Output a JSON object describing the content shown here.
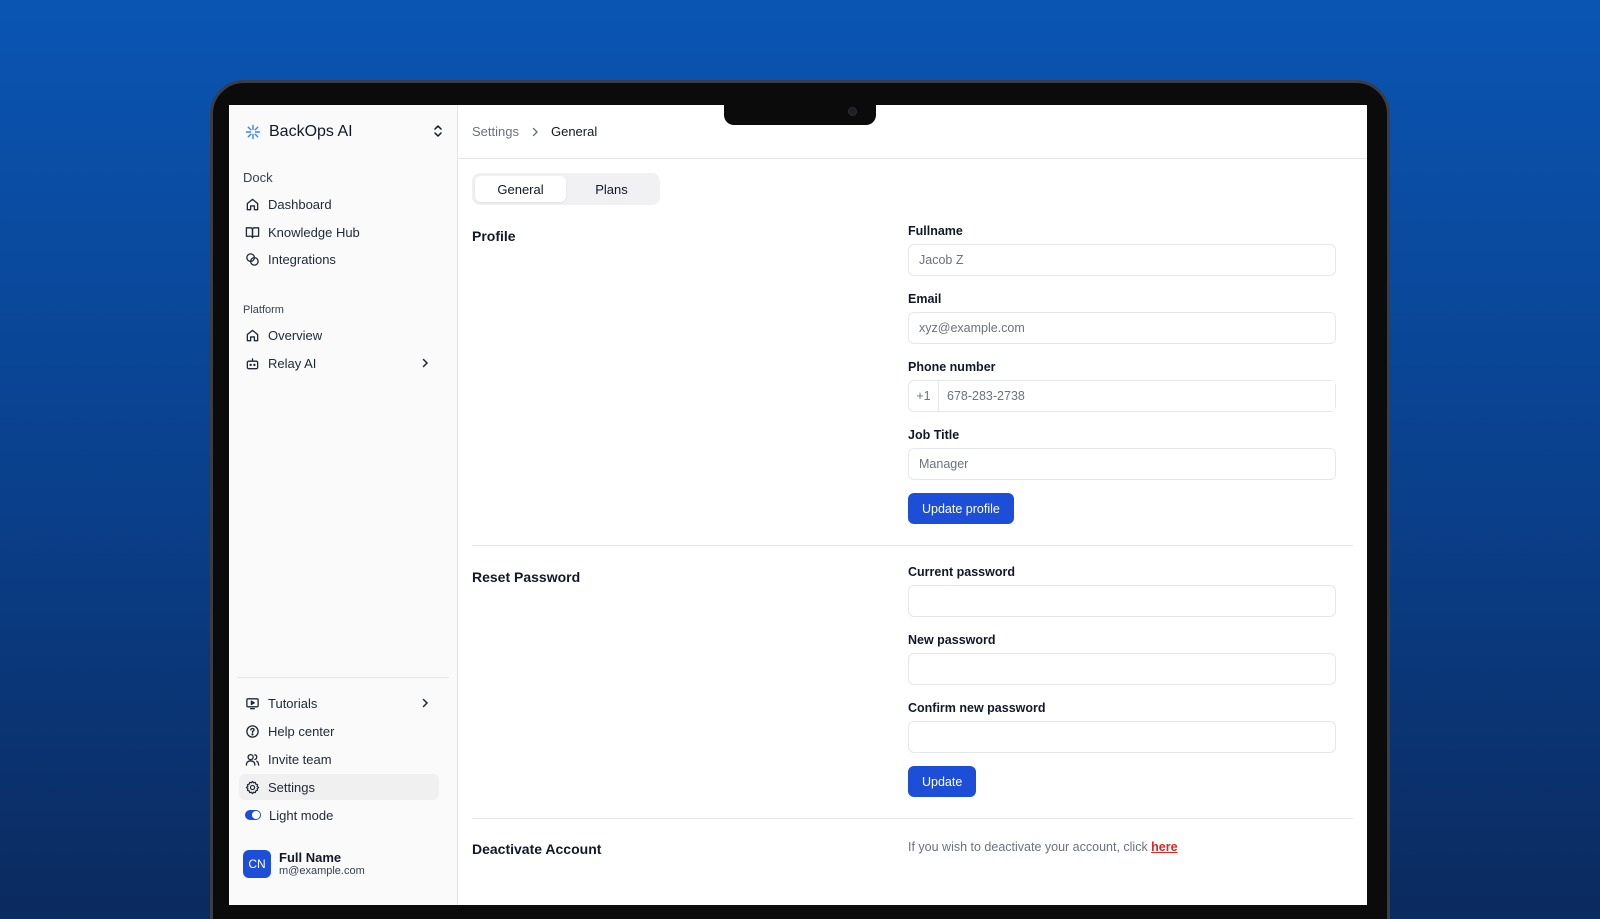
{
  "brand": {
    "name": "BackOps AI"
  },
  "sidebar": {
    "dock_label": "Dock",
    "dock_items": [
      {
        "label": "Dashboard",
        "icon": "home-icon"
      },
      {
        "label": "Knowledge Hub",
        "icon": "book-icon"
      },
      {
        "label": "Integrations",
        "icon": "integrations-icon"
      }
    ],
    "platform_label": "Platform",
    "platform_items": [
      {
        "label": "Overview",
        "icon": "home-icon"
      },
      {
        "label": "Relay AI",
        "icon": "bot-icon"
      }
    ],
    "footer_items": [
      {
        "label": "Tutorials",
        "icon": "video-icon"
      },
      {
        "label": "Help center",
        "icon": "help-icon"
      },
      {
        "label": "Invite team",
        "icon": "users-icon"
      },
      {
        "label": "Settings",
        "icon": "gear-icon"
      },
      {
        "label": "Light mode",
        "icon": "toggle-icon"
      }
    ],
    "active_item": "Settings",
    "user": {
      "initials": "CN",
      "name": "Full Name",
      "email": "m@example.com"
    }
  },
  "breadcrumb": {
    "parent": "Settings",
    "current": "General"
  },
  "tabs": [
    {
      "label": "General",
      "active": true
    },
    {
      "label": "Plans",
      "active": false
    }
  ],
  "profile": {
    "title": "Profile",
    "fullname_label": "Fullname",
    "fullname_placeholder": "Jacob Z",
    "email_label": "Email",
    "email_placeholder": "xyz@example.com",
    "phone_label": "Phone number",
    "phone_code": "+1",
    "phone_placeholder": "678-283-2738",
    "job_label": "Job Title",
    "job_placeholder": "Manager",
    "submit_label": "Update profile"
  },
  "password": {
    "title": "Reset Password",
    "current_label": "Current password",
    "new_label": "New password",
    "confirm_label": "Confirm new password",
    "submit_label": "Update"
  },
  "deactivate": {
    "title": "Deactivate Account",
    "text": "If you wish to deactivate your account, click ",
    "link": "here"
  },
  "colors": {
    "accent": "#1d4ed8",
    "danger": "#dc2626"
  }
}
